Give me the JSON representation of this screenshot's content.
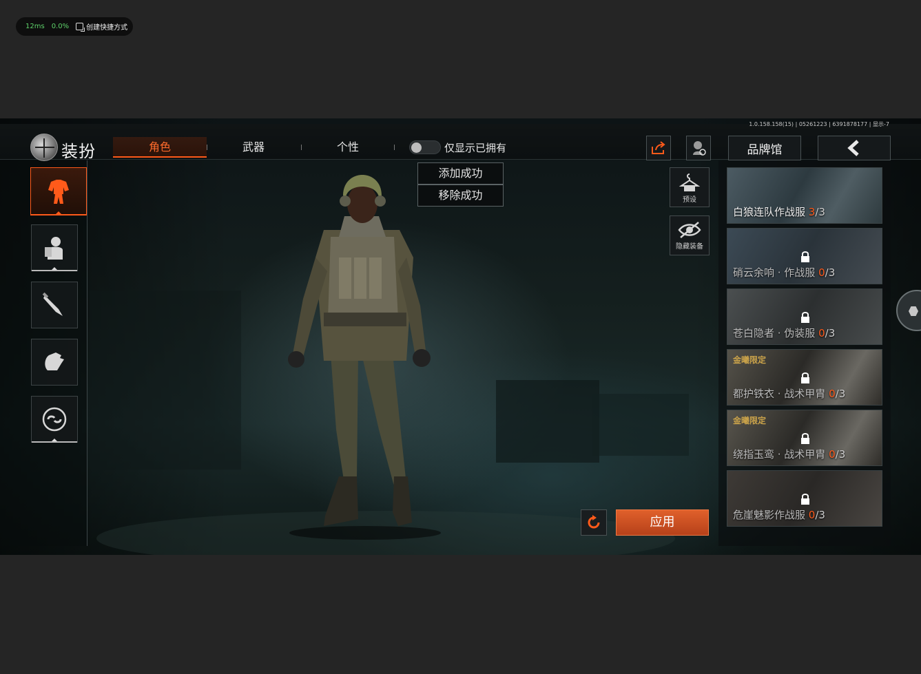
{
  "perf": {
    "latency": "12ms",
    "cpu": "0.0%",
    "shortcut_label": "创建快捷方式"
  },
  "version": "1.0.158.158(15) | 05261223 | 6391878177 | 显示-7",
  "header": {
    "title": "装扮",
    "tabs": [
      {
        "label": "角色",
        "active": true
      },
      {
        "label": "武器",
        "active": false
      },
      {
        "label": "个性",
        "active": false
      }
    ],
    "toggle_label": "仅显示已拥有",
    "brand_button": "品牌馆"
  },
  "left_slots": [
    {
      "icon": "outfit-icon",
      "active": true
    },
    {
      "icon": "face-mask-icon",
      "active": false
    },
    {
      "icon": "knife-icon",
      "active": false
    },
    {
      "icon": "glove-icon",
      "active": false
    },
    {
      "icon": "link-icon",
      "active": false
    }
  ],
  "toasts": {
    "added": "添加成功",
    "removed": "移除成功"
  },
  "tools": {
    "preset": "预设",
    "hide_gear": "隐藏装备"
  },
  "outfits": [
    {
      "name": "白狼连队作战服",
      "owned": "3",
      "total": "/3",
      "locked": false,
      "tag": ""
    },
    {
      "name": "硝云余响 · 作战服",
      "owned": "0",
      "total": "/3",
      "locked": true,
      "tag": ""
    },
    {
      "name": "苍白隐者 · 伪装服",
      "owned": "0",
      "total": "/3",
      "locked": true,
      "tag": ""
    },
    {
      "name": "都护铁衣 · 战术甲胄",
      "owned": "0",
      "total": "/3",
      "locked": true,
      "tag": "金曦限定"
    },
    {
      "name": "绕指玉鸾 · 战术甲胄",
      "owned": "0",
      "total": "/3",
      "locked": true,
      "tag": "金曦限定"
    },
    {
      "name": "危崖魅影作战服",
      "owned": "0",
      "total": "/3",
      "locked": true,
      "tag": ""
    }
  ],
  "apply_button": "应用",
  "colors": {
    "accent": "#ff5a1a",
    "bg": "#252525"
  }
}
